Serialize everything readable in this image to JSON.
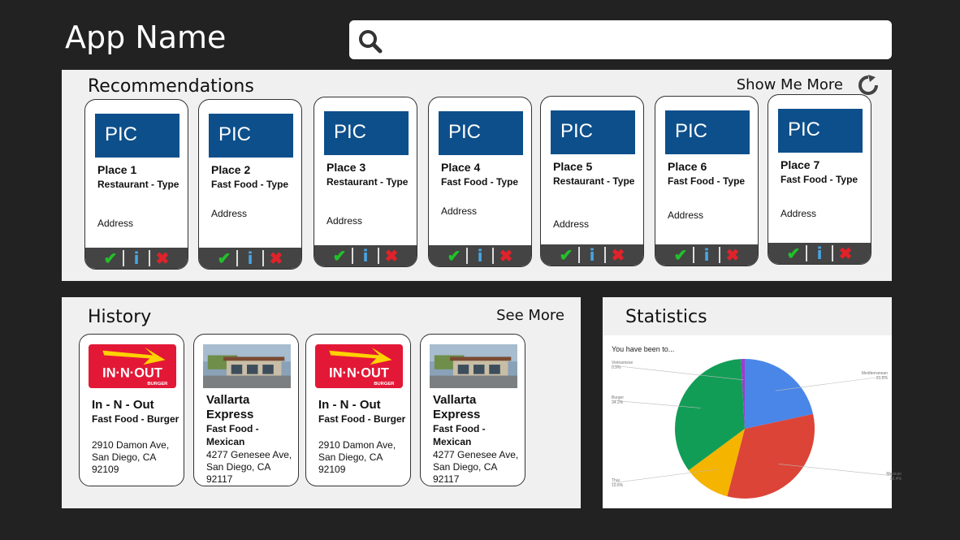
{
  "app": {
    "title": "App Name"
  },
  "search": {
    "placeholder": ""
  },
  "recommendations": {
    "title": "Recommendations",
    "more_label": "Show Me More",
    "cards": [
      {
        "pic": "PIC",
        "name": "Place 1",
        "type": "Restaurant - Type",
        "address": "Address",
        "actions": {
          "check": "✔",
          "info": "i",
          "dismiss": "✖"
        }
      },
      {
        "pic": "PIC",
        "name": "Place 2",
        "type": "Fast Food - Type",
        "address": "Address",
        "actions": {
          "check": "✔",
          "info": "i",
          "dismiss": "✖"
        }
      },
      {
        "pic": "PIC",
        "name": "Place 3",
        "type": "Restaurant - Type",
        "address": "Address",
        "actions": {
          "check": "✔",
          "info": "i",
          "dismiss": "✖"
        }
      },
      {
        "pic": "PIC",
        "name": "Place 4",
        "type": "Fast Food - Type",
        "address": "Address",
        "actions": {
          "check": "✔",
          "info": "i",
          "dismiss": "✖"
        }
      },
      {
        "pic": "PIC",
        "name": "Place 5",
        "type": "Restaurant - Type",
        "address": "Address",
        "actions": {
          "check": "✔",
          "info": "i",
          "dismiss": "✖"
        }
      },
      {
        "pic": "PIC",
        "name": "Place 6",
        "type": "Fast Food - Type",
        "address": "Address",
        "actions": {
          "check": "✔",
          "info": "i",
          "dismiss": "✖"
        }
      },
      {
        "pic": "PIC",
        "name": "Place 7",
        "type": "Fast Food - Type",
        "address": "Address",
        "actions": {
          "check": "✔",
          "info": "i",
          "dismiss": "✖"
        }
      }
    ]
  },
  "history": {
    "title": "History",
    "more_label": "See More",
    "cards": [
      {
        "logo": "IN-N-OUT BURGER",
        "name": "In - N - Out",
        "type": "Fast Food - Burger",
        "address": "2910 Damon Ave, San Diego, CA 92109"
      },
      {
        "logo": "",
        "name": "Vallarta Express",
        "type": "Fast Food - Mexican",
        "address": "4277 Genesee Ave, San Diego, CA 92117"
      },
      {
        "logo": "IN-N-OUT BURGER",
        "name": "In - N - Out",
        "type": "Fast Food - Burger",
        "address": "2910 Damon Ave, San Diego, CA 92109"
      },
      {
        "logo": "",
        "name": "Vallarta Express",
        "type": "Fast Food - Mexican",
        "address": "4277 Genesee Ave, San Diego, CA 92117"
      }
    ]
  },
  "statistics": {
    "title": "Statistics",
    "chart_caption": "You have been to..."
  },
  "colors": {
    "background": "#222222",
    "panel": "#f0f0f0",
    "pic": "#0d4f8b",
    "check": "#22c02a",
    "info": "#47a6e6",
    "dismiss": "#e0222a"
  },
  "chart_data": {
    "type": "pie",
    "title": "You have been to...",
    "series": [
      {
        "name": "Mediterranean",
        "value": 21.6,
        "percent_label": "21.6%",
        "color": "#4a86e8"
      },
      {
        "name": "Mexican",
        "value": 32.4,
        "percent_label": "32.4%",
        "color": "#dc4437"
      },
      {
        "name": "Thai",
        "value": 10.8,
        "percent_label": "10.8%",
        "color": "#f4b400"
      },
      {
        "name": "Burger",
        "value": 34.2,
        "percent_label": "34.2%",
        "color": "#129d57"
      },
      {
        "name": "Vietnamese",
        "value": 0.9,
        "percent_label": "0.9%",
        "color": "#9c3dcc"
      }
    ],
    "legend": "outside labels"
  }
}
